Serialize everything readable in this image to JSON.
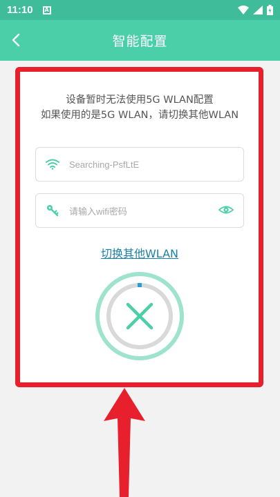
{
  "status_bar": {
    "time": "11:10",
    "notification_badge": "A"
  },
  "header": {
    "title": "智能配置"
  },
  "message": {
    "line1": "设备暂时无法使用5G WLAN配置",
    "line2": "如果使用的是5G WLAN，请切换其他WLAN"
  },
  "wifi_field": {
    "value": "Searching-PsfLtE"
  },
  "password_field": {
    "placeholder": "请输入wifi密码"
  },
  "switch_link": "切换其他WLAN",
  "colors": {
    "accent": "#4bcfa9",
    "status_bar": "#3fbd9a",
    "link": "#1a7fa8",
    "annotation_red": "#e8202e"
  }
}
